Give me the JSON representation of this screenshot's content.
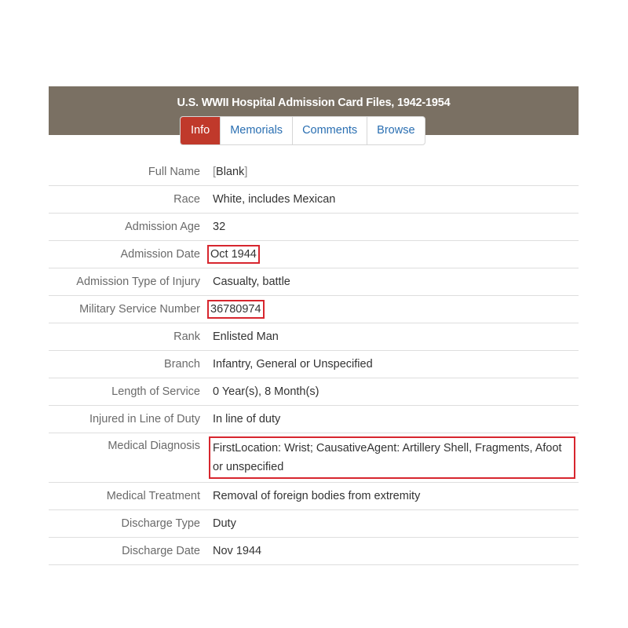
{
  "header": {
    "title": "U.S. WWII Hospital Admission Card Files, 1942-1954",
    "background_color": "#7a7063"
  },
  "tabs": [
    {
      "label": "Info",
      "active": true
    },
    {
      "label": "Memorials",
      "active": false
    },
    {
      "label": "Comments",
      "active": false
    },
    {
      "label": "Browse",
      "active": false
    }
  ],
  "accent_color": "#c0392b",
  "highlight_color": "#d7262e",
  "fields": [
    {
      "label": "Full Name",
      "value": "Blank"
    },
    {
      "label": "Race",
      "value": "White, includes Mexican"
    },
    {
      "label": "Admission Age",
      "value": "32"
    },
    {
      "label": "Admission Date",
      "value": "Oct 1944",
      "highlighted": true
    },
    {
      "label": "Admission Type of Injury",
      "value": "Casualty, battle"
    },
    {
      "label": "Military Service Number",
      "value": "36780974",
      "highlighted": true
    },
    {
      "label": "Rank",
      "value": "Enlisted Man"
    },
    {
      "label": "Branch",
      "value": "Infantry, General or Unspecified"
    },
    {
      "label": "Length of Service",
      "value": "0 Year(s), 8 Month(s)"
    },
    {
      "label": "Injured in Line of Duty",
      "value": "In line of duty"
    },
    {
      "label": "Medical Diagnosis",
      "value": "FirstLocation: Wrist; CausativeAgent: Artillery Shell, Fragments, Afoot or unspecified",
      "highlighted": true
    },
    {
      "label": "Medical Treatment",
      "value": "Removal of foreign bodies from extremity"
    },
    {
      "label": "Discharge Type",
      "value": "Duty"
    },
    {
      "label": "Discharge Date",
      "value": "Nov 1944"
    }
  ]
}
